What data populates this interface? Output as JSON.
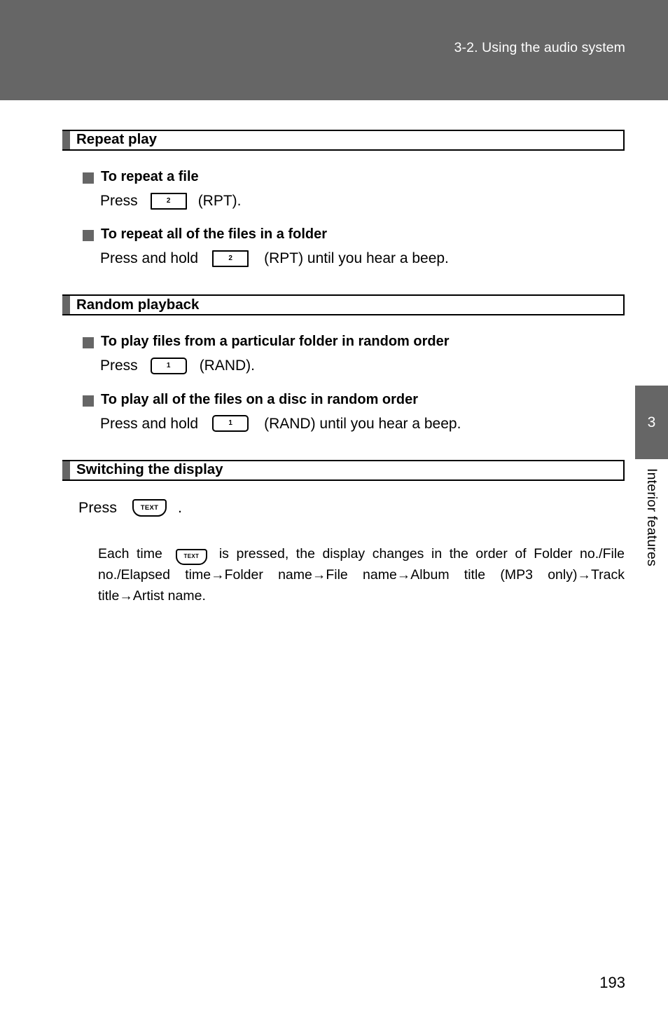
{
  "header": {
    "title": "3-2. Using the audio system"
  },
  "sections": [
    {
      "title": "Repeat play",
      "items": [
        {
          "heading": "To repeat a file",
          "press_verb": "Press",
          "key": "2",
          "suffix": "(RPT)."
        },
        {
          "heading": "To repeat all of the files in a folder",
          "press_verb": "Press and hold",
          "key": "2",
          "suffix": "(RPT) until you hear a beep."
        }
      ]
    },
    {
      "title": "Random playback",
      "items": [
        {
          "heading": "To play files from a particular folder in random order",
          "press_verb": "Press",
          "key": "1",
          "suffix": "(RAND)."
        },
        {
          "heading": "To play all of the files on a disc in random order",
          "press_verb": "Press and hold",
          "key": "1",
          "suffix": "(RAND) until you hear a beep."
        }
      ]
    },
    {
      "title": "Switching the display",
      "press_line": {
        "press_verb": "Press",
        "key": "TEXT",
        "suffix": "."
      },
      "body": {
        "lead": "Each time",
        "key": "TEXT",
        "rest": "is pressed, the display changes in the order of Folder no./File no./Elapsed time→Folder name→File name→Album title (MP3 only)→Track title→Artist name."
      }
    }
  ],
  "chapter_tab": {
    "number": "3",
    "label": "Interior features"
  },
  "page_number": "193",
  "colors": {
    "header_band": "#666666",
    "tab": "#666666",
    "bullet": "#666666",
    "text": "#000000"
  }
}
